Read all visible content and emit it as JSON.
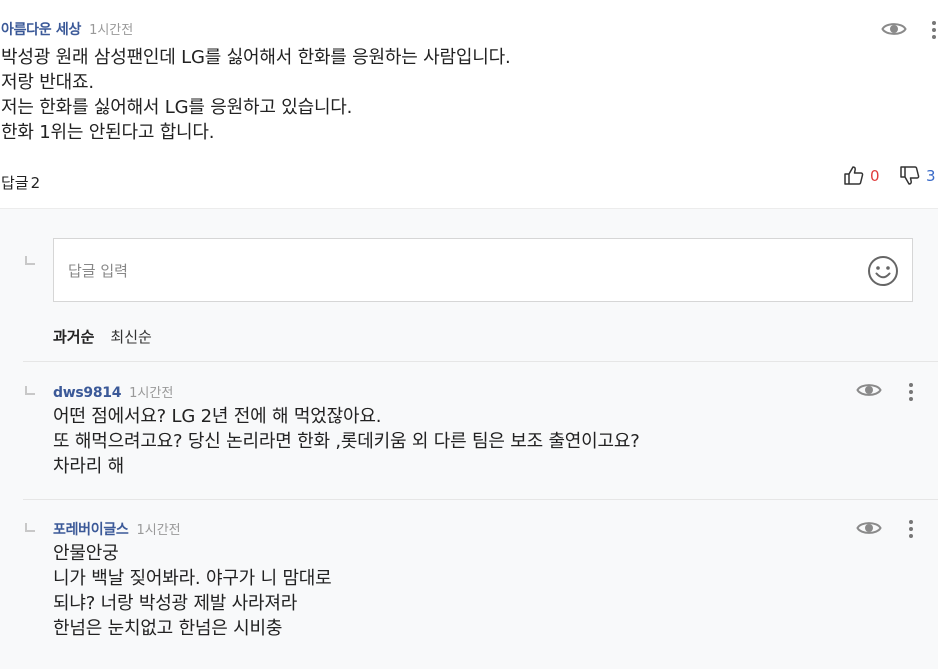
{
  "comment": {
    "author": "아름다운 세상",
    "time": "1시간전",
    "lines": [
      "박성광 원래 삼성팬인데 LG를 싫어해서 한화를 응원하는 사람입니다.",
      "저랑 반대죠.",
      "저는 한화를 싫어해서 LG를 응원하고 있습니다.",
      "한화 1위는 안된다고 합니다."
    ],
    "reply_label": "답글",
    "reply_count": "2",
    "likes": "0",
    "dislikes": "3"
  },
  "reply_input": {
    "placeholder": "답글 입력"
  },
  "sort": {
    "oldest": "과거순",
    "newest": "최신순"
  },
  "replies": [
    {
      "author": "dws9814",
      "time": "1시간전",
      "lines": [
        "어떤 점에서요? LG 2년 전에 해 먹었잖아요.",
        "또 해먹으려고요? 당신 논리라면 한화 ,롯데키움 외 다른 팀은 보조 출연이고요?",
        "차라리 해"
      ]
    },
    {
      "author": "포레버이글스",
      "time": "1시간전",
      "lines": [
        "안물안궁",
        "니가 백날 짖어봐라. 야구가 니 맘대로",
        "되냐? 너랑 박성광 제발 사라져라",
        "한넘은 눈치없고 한넘은 시비충"
      ]
    }
  ],
  "icons": {
    "view": "eye-icon",
    "more": "more-vertical-icon",
    "like": "thumbs-up-icon",
    "dislike": "thumbs-down-icon",
    "emoji": "smiley-icon",
    "reply_indent": "reply-corner-icon"
  },
  "colors": {
    "author": "#3b5998",
    "like_count": "#e03c3c",
    "dislike_count": "#3b6bc8",
    "reply_area_bg": "#f8f9fa"
  }
}
